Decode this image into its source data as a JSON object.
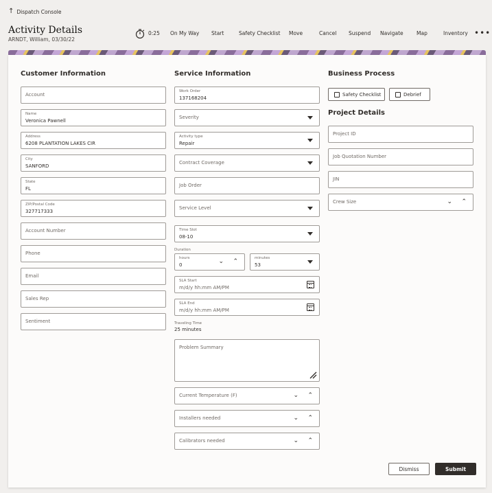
{
  "header": {
    "back_label": "Dispatch Console",
    "title": "Activity Details",
    "subtitle": "ARNDT, William, 03/30/22"
  },
  "toolbar": {
    "timer": "0:25",
    "actions": [
      "On My Way",
      "Start",
      "Safety Checklist",
      "Move",
      "Cancel",
      "Suspend",
      "Navigate",
      "Map",
      "Inventory"
    ],
    "more": "•••"
  },
  "customer": {
    "title": "Customer Information",
    "account": "Account",
    "name_label": "Name",
    "name_value": "Veronica Pawnell",
    "address_label": "Address",
    "address_value": "6208  PLANTATION LAKES CIR",
    "city_label": "City",
    "city_value": "SANFORD",
    "state_label": "State",
    "state_value": "FL",
    "zip_label": "ZIP/Postal Code",
    "zip_value": "327717333",
    "account_number": "Account Number",
    "phone": "Phone",
    "email": "Email",
    "sales_rep": "Sales Rep",
    "sentiment": "Sentiment"
  },
  "service": {
    "title": "Service Information",
    "work_order_label": "Work Order",
    "work_order_value": "137168204",
    "severity": "Severity",
    "activity_type_label": "Activity type",
    "activity_type_value": "Repair",
    "contract_coverage": "Contract Coverage",
    "job_order": "Job Order",
    "service_level": "Service Level",
    "time_slot_label": "Time Slot",
    "time_slot_value": "08-10",
    "duration_label": "Duration",
    "hours_label": "hours",
    "hours_value": "0",
    "minutes_label": "minutes",
    "minutes_value": "53",
    "sla_start_label": "SLA Start",
    "sla_start_placeholder": "m/d/y hh:mm AM/PM",
    "sla_end_label": "SLA End",
    "sla_end_placeholder": "m/d/y hh:mm AM/PM",
    "traveling_label": "Traveling Time",
    "traveling_value": "25 minutes",
    "problem_summary": "Problem Summary",
    "current_temp": "Current Temperature (F)",
    "installers": "Installers needed",
    "calibrators": "Calibrators needed"
  },
  "business": {
    "title": "Business Process",
    "safety_checklist": "Safety Checklist",
    "debrief": "Debrief"
  },
  "project": {
    "title": "Project Details",
    "project_id": "Project ID",
    "job_quotation": "Job Quotation Number",
    "jin": "JIN",
    "crew_size": "Crew Size"
  },
  "footer": {
    "dismiss": "Dismiss",
    "submit": "Submit"
  }
}
